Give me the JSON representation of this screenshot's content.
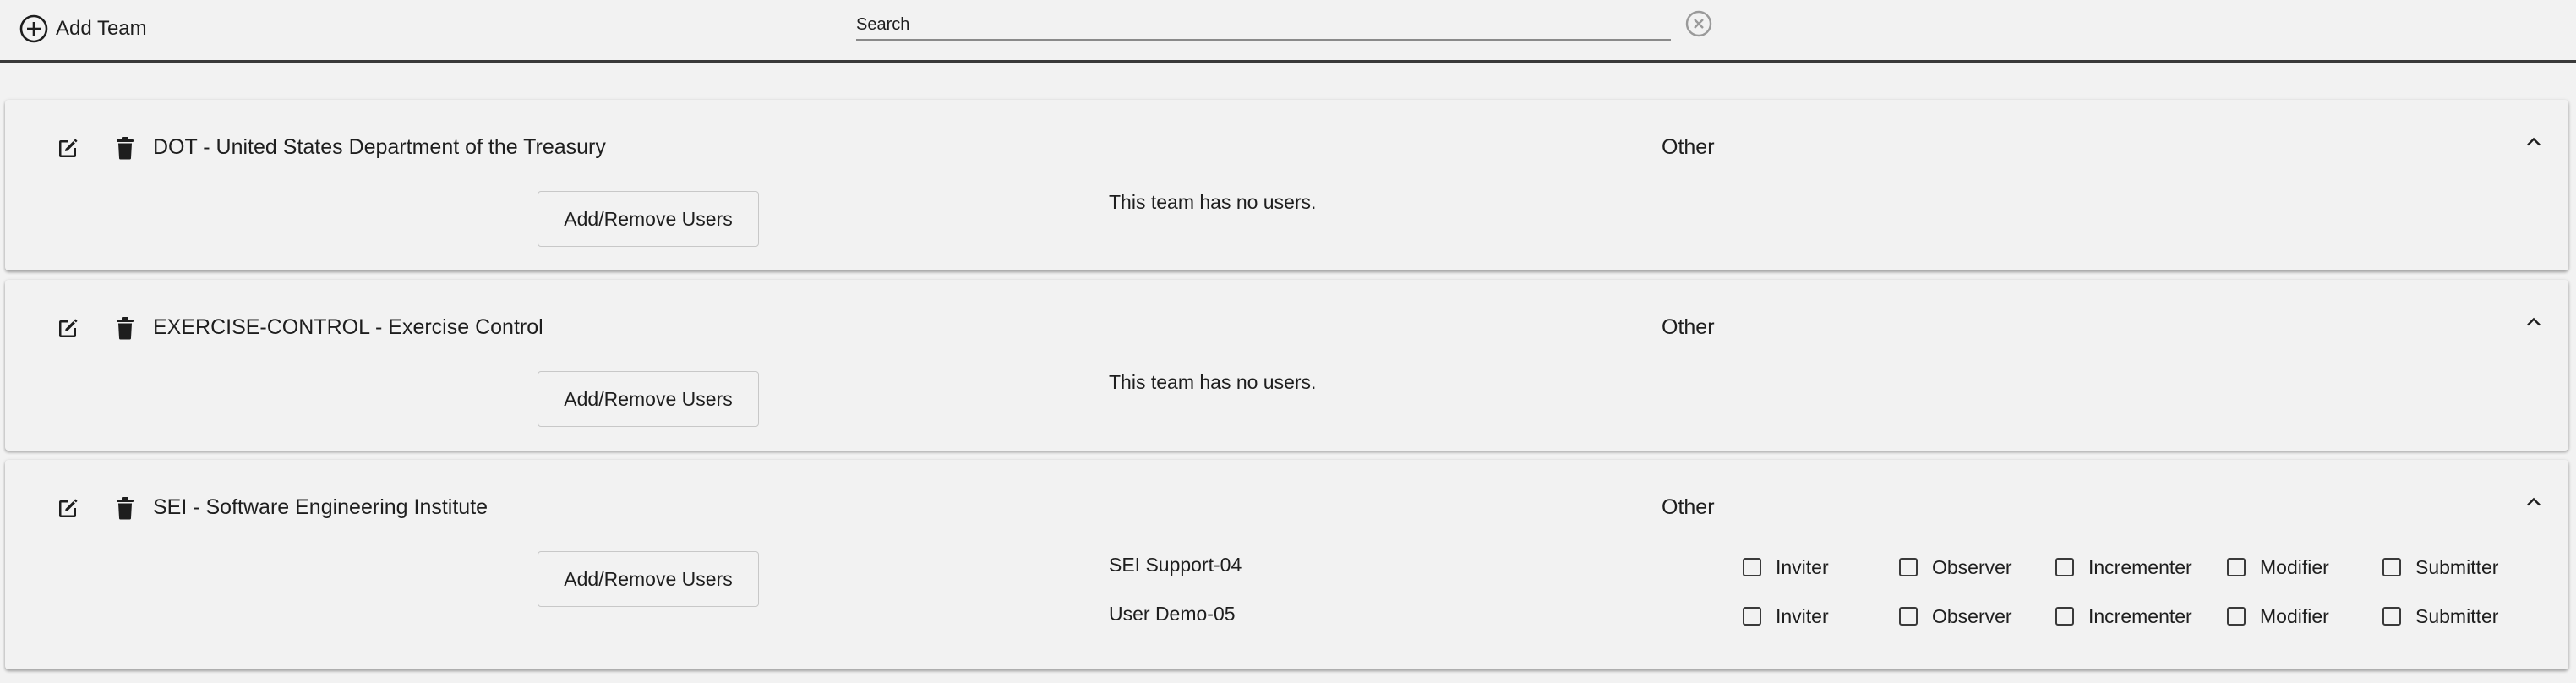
{
  "toolbar": {
    "add_team_label": "Add Team",
    "search_placeholder": "Search"
  },
  "no_users_text": "This team has no users.",
  "add_remove_users_label": "Add/Remove Users",
  "roles": [
    "Inviter",
    "Observer",
    "Incrementer",
    "Modifier",
    "Submitter"
  ],
  "teams": [
    {
      "name": "DOT - United States Department of the Treasury",
      "type": "Other",
      "users": []
    },
    {
      "name": "EXERCISE-CONTROL - Exercise Control",
      "type": "Other",
      "users": []
    },
    {
      "name": "SEI - Software Engineering Institute",
      "type": "Other",
      "users": [
        {
          "name": "SEI Support-04",
          "roles": {
            "Inviter": false,
            "Observer": false,
            "Incrementer": false,
            "Modifier": false,
            "Submitter": false
          }
        },
        {
          "name": "User Demo-05",
          "roles": {
            "Inviter": false,
            "Observer": false,
            "Incrementer": false,
            "Modifier": false,
            "Submitter": false
          }
        }
      ]
    }
  ]
}
